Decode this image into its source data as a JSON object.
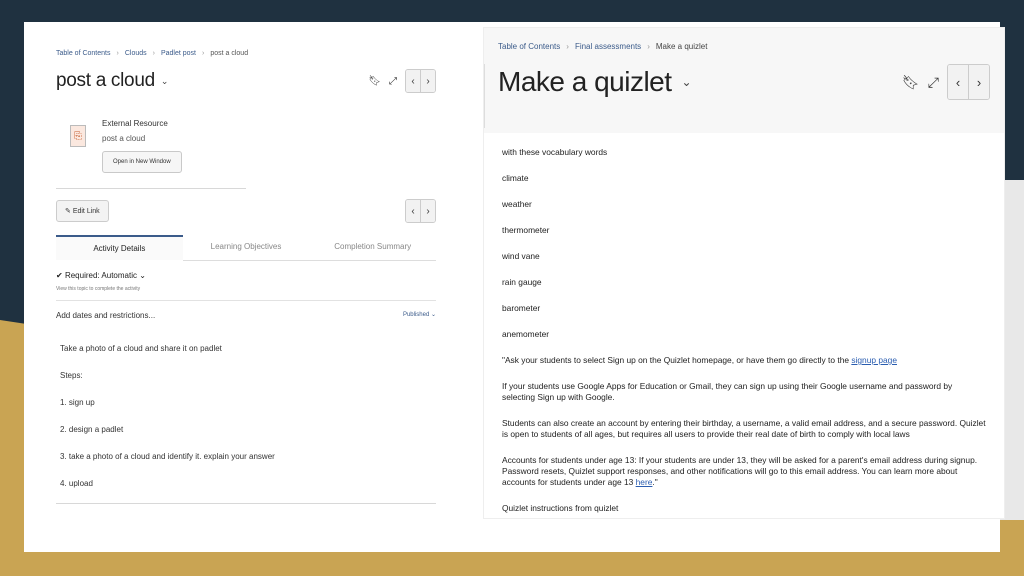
{
  "left": {
    "breadcrumb": [
      "Table of Contents",
      "Clouds",
      "Padlet post",
      "post a cloud"
    ],
    "title": "post a cloud",
    "resource": {
      "type": "External Resource",
      "name": "post a cloud",
      "open_button": "Open in New Window"
    },
    "edit_link": "Edit Link",
    "tabs": [
      "Activity Details",
      "Learning Objectives",
      "Completion Summary"
    ],
    "required": "Required: Automatic",
    "required_note": "View this topic to complete the activity",
    "add_dates": "Add dates and restrictions...",
    "published": "Published",
    "body": [
      "Take a photo of a cloud and share it on padlet",
      "Steps:",
      "1. sign up",
      "2. design a padlet",
      "3. take a photo of a cloud and identify it. explain your answer",
      "4. upload"
    ]
  },
  "right": {
    "breadcrumb": [
      "Table of Contents",
      "Final assessments",
      "Make a quizlet"
    ],
    "title": "Make a quizlet",
    "intro": "with these vocabulary words",
    "words": [
      "climate",
      "weather",
      "thermometer",
      "wind vane",
      "rain gauge",
      "barometer",
      "anemometer"
    ],
    "p1_text": "\"Ask your students to select Sign up on the Quizlet homepage, or have them go directly to the",
    "p1_link": "signup page",
    "p2": "If your students use Google Apps for Education or Gmail, they can sign up using their Google username and password by selecting Sign up with Google.",
    "p3": "Students can also create an account by entering their birthday, a username, a valid email address, and a secure password. Quizlet is open to students of all ages, but requires all users to provide their real date of birth to comply with local laws",
    "p4_text": "Accounts for students under age 13: If your students are under 13, they will be asked for a parent's email address during signup. Password resets, Quizlet support responses, and other notifications will go to this email address. You can learn more about accounts for students under age 13",
    "p4_link": "here",
    "p4_end": ".\"",
    "p5": "Quizlet instructions from quizlet"
  }
}
